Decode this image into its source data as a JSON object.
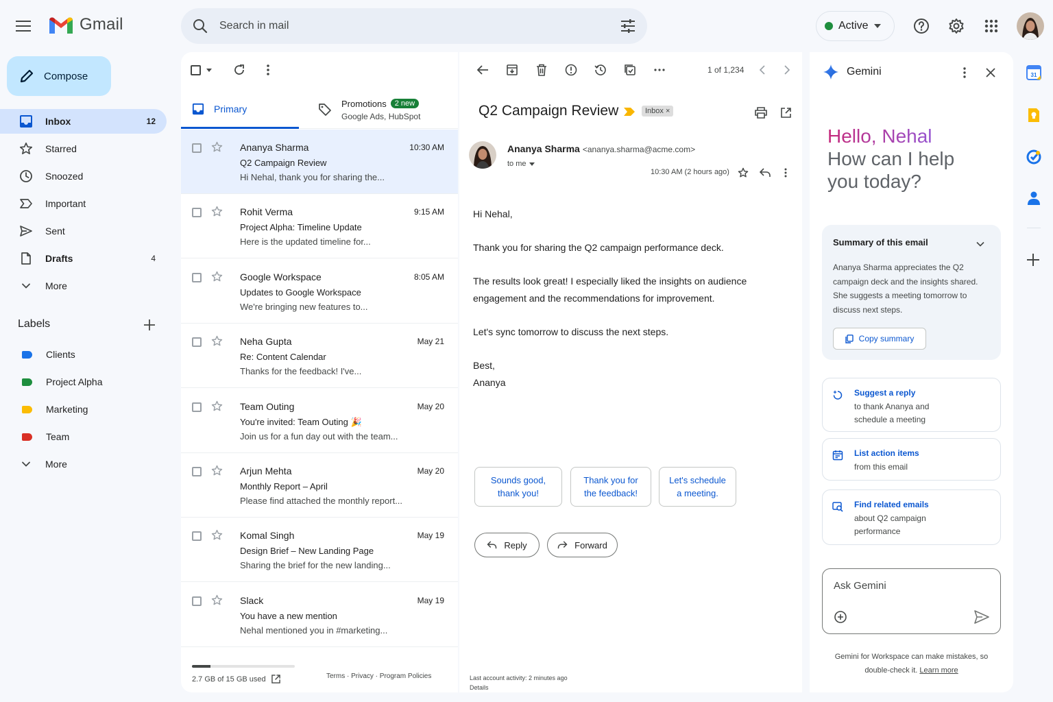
{
  "header": {
    "app_name": "Gmail",
    "search_placeholder": "Search in mail",
    "status": "Active"
  },
  "sidebar": {
    "compose": "Compose",
    "items": [
      {
        "label": "Inbox",
        "count": "12",
        "icon": "inbox-icon"
      },
      {
        "label": "Starred",
        "count": "",
        "icon": "star-icon"
      },
      {
        "label": "Snoozed",
        "count": "",
        "icon": "clock-icon"
      },
      {
        "label": "Important",
        "count": "",
        "icon": "label-important-icon"
      },
      {
        "label": "Sent",
        "count": "",
        "icon": "send-icon"
      },
      {
        "label": "Drafts",
        "count": "4",
        "icon": "draft-icon"
      },
      {
        "label": "More",
        "count": "",
        "icon": "chevron-down-icon"
      }
    ],
    "labels_heading": "Labels",
    "labels": [
      {
        "label": "Clients",
        "color": "#1a73e8"
      },
      {
        "label": "Project Alpha",
        "color": "#1e8e3e"
      },
      {
        "label": "Marketing",
        "color": "#fbbc04"
      },
      {
        "label": "Team",
        "color": "#d93025"
      }
    ],
    "labels_more": "More"
  },
  "list": {
    "tabs": {
      "primary": "Primary",
      "promotions": "Promotions",
      "promotions_badge": "2 new",
      "promotions_senders": "Google Ads, HubSpot"
    },
    "messages": [
      {
        "from": "Ananya Sharma",
        "time": "10:30 AM",
        "subject": "Q2 Campaign Review",
        "snippet": "Hi Nehal, thank you for sharing the..."
      },
      {
        "from": "Rohit Verma",
        "time": "9:15 AM",
        "subject": "Project Alpha: Timeline Update",
        "snippet": "Here is the updated timeline for..."
      },
      {
        "from": "Google Workspace",
        "time": "8:05 AM",
        "subject": "Updates to Google Workspace",
        "snippet": "We're bringing new features to..."
      },
      {
        "from": "Neha Gupta",
        "time": "May 21",
        "subject": "Re: Content Calendar",
        "snippet": "Thanks for the feedback! I've..."
      },
      {
        "from": "Team Outing",
        "time": "May 20",
        "subject": "You're invited: Team Outing 🎉",
        "snippet": "Join us for a fun day out with the team..."
      },
      {
        "from": "Arjun Mehta",
        "time": "May 20",
        "subject": "Monthly Report – April",
        "snippet": "Please find attached the monthly report..."
      },
      {
        "from": "Komal Singh",
        "time": "May 19",
        "subject": "Design Brief – New Landing Page",
        "snippet": "Sharing the brief for the new landing..."
      },
      {
        "from": "Slack",
        "time": "May 19",
        "subject": "You have a new mention",
        "snippet": "Nehal mentioned you in #marketing..."
      }
    ],
    "storage_text": "2.7 GB of 15 GB used",
    "storage_fraction": 0.18,
    "footer_links": "Terms · Privacy · Program Policies"
  },
  "reader": {
    "pager": "1 of 1,234",
    "subject": "Q2 Campaign Review",
    "chip": "Inbox",
    "sender_name": "Ananya Sharma",
    "sender_email": "<ananya.sharma@acme.com>",
    "to": "to me",
    "time": "10:30 AM (2 hours ago)",
    "body": [
      "Hi Nehal,",
      "Thank you for sharing the Q2 campaign performance deck.",
      "The results look great! I especially liked the insights on audience engagement and the recommendations for improvement.",
      "Let's sync tomorrow to discuss the next steps.",
      "Best,",
      "Ananya"
    ],
    "smart_replies": [
      "Sounds good, thank you!",
      "Thank you for the feedback!",
      "Let's schedule a meeting."
    ],
    "reply": "Reply",
    "forward": "Forward",
    "activity": "Last account activity: 2 minutes ago",
    "details": "Details"
  },
  "gemini": {
    "title": "Gemini",
    "hello": "Hello, Nehal",
    "help": "How can I help you today?",
    "summary_title": "Summary of this email",
    "summary_text": "Ananya Sharma appreciates the Q2 campaign deck and the insights shared. She suggests a meeting tomorrow to discuss next steps.",
    "copy_summary": "Copy summary",
    "cards": [
      {
        "title": "Suggest a reply",
        "desc": "to thank Ananya and schedule a meeting",
        "icon": "sparkle-reply-icon"
      },
      {
        "title": "List action items",
        "desc": "from this email",
        "icon": "calendar-list-icon"
      },
      {
        "title": "Find related emails",
        "desc": "about Q2 campaign performance",
        "icon": "search-mail-icon"
      }
    ],
    "ask_placeholder": "Ask Gemini",
    "disclaimer": "Gemini for Workspace can make mistakes, so double-check it.",
    "learn_more": "Learn more"
  }
}
